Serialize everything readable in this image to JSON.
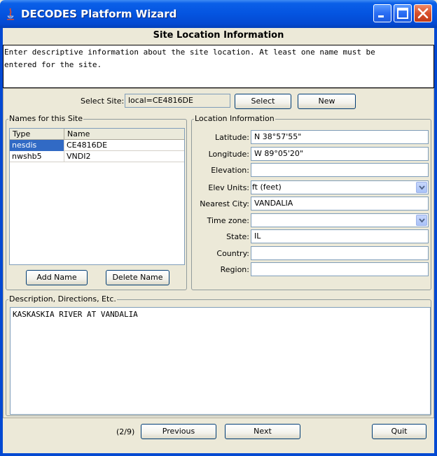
{
  "window": {
    "title": "DECODES Platform Wizard"
  },
  "page_title": "Site Location Information",
  "instructions": "Enter descriptive information about the site location. At least one name must be\nentered for the site.",
  "select_site": {
    "label": "Select Site:",
    "value": "local=CE4816DE",
    "select_label": "Select",
    "new_label": "New"
  },
  "names": {
    "group_title": "Names for this Site",
    "columns": [
      "Type",
      "Name"
    ],
    "rows": [
      {
        "type": "nesdis",
        "name": "CE4816DE"
      },
      {
        "type": "nwshb5",
        "name": "VNDI2"
      }
    ],
    "add_label": "Add Name",
    "delete_label": "Delete Name"
  },
  "location": {
    "group_title": "Location Information",
    "latitude": {
      "label": "Latitude:",
      "value": "N 38°57'55\""
    },
    "longitude": {
      "label": "Longitude:",
      "value": " W 89°05'20\""
    },
    "elevation": {
      "label": "Elevation:",
      "value": ""
    },
    "elev_units": {
      "label": "Elev Units:",
      "value": "ft (feet)"
    },
    "nearest_city": {
      "label": "Nearest City:",
      "value": " VANDALIA"
    },
    "time_zone": {
      "label": "Time zone:",
      "value": ""
    },
    "state": {
      "label": "State:",
      "value": "IL"
    },
    "country": {
      "label": "Country:",
      "value": ""
    },
    "region": {
      "label": "Region:",
      "value": ""
    }
  },
  "description": {
    "group_title": "Description, Directions, Etc.",
    "text": "KASKASKIA RIVER AT VANDALIA"
  },
  "footer": {
    "page_indicator": "(2/9)",
    "previous_label": "Previous",
    "next_label": "Next",
    "quit_label": "Quit"
  },
  "colors": {
    "titlebar": "#0454e0",
    "selection": "#316ac5",
    "panel": "#ece9d8"
  }
}
